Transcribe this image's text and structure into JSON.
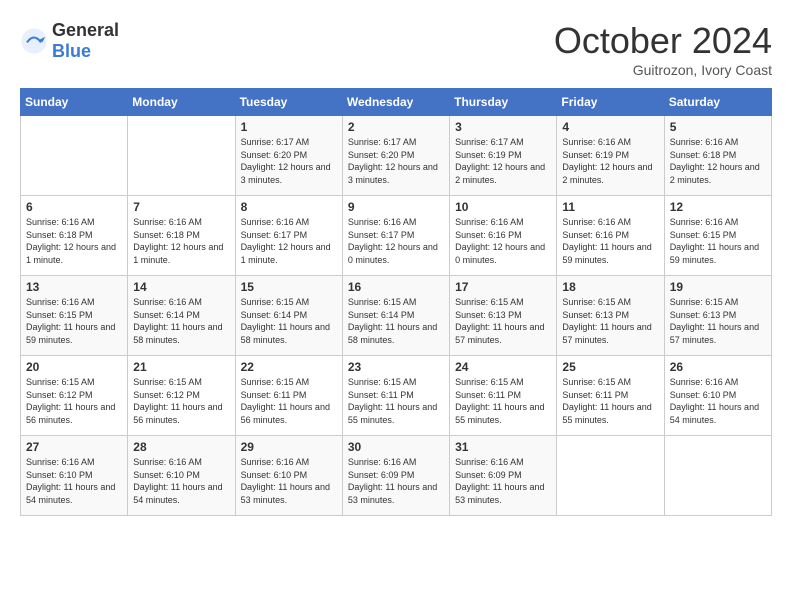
{
  "header": {
    "logo_general": "General",
    "logo_blue": "Blue",
    "month_title": "October 2024",
    "location": "Guitrozon, Ivory Coast"
  },
  "days_of_week": [
    "Sunday",
    "Monday",
    "Tuesday",
    "Wednesday",
    "Thursday",
    "Friday",
    "Saturday"
  ],
  "weeks": [
    [
      {
        "day": "",
        "info": ""
      },
      {
        "day": "",
        "info": ""
      },
      {
        "day": "1",
        "info": "Sunrise: 6:17 AM\nSunset: 6:20 PM\nDaylight: 12 hours and 3 minutes."
      },
      {
        "day": "2",
        "info": "Sunrise: 6:17 AM\nSunset: 6:20 PM\nDaylight: 12 hours and 3 minutes."
      },
      {
        "day": "3",
        "info": "Sunrise: 6:17 AM\nSunset: 6:19 PM\nDaylight: 12 hours and 2 minutes."
      },
      {
        "day": "4",
        "info": "Sunrise: 6:16 AM\nSunset: 6:19 PM\nDaylight: 12 hours and 2 minutes."
      },
      {
        "day": "5",
        "info": "Sunrise: 6:16 AM\nSunset: 6:18 PM\nDaylight: 12 hours and 2 minutes."
      }
    ],
    [
      {
        "day": "6",
        "info": "Sunrise: 6:16 AM\nSunset: 6:18 PM\nDaylight: 12 hours and 1 minute."
      },
      {
        "day": "7",
        "info": "Sunrise: 6:16 AM\nSunset: 6:18 PM\nDaylight: 12 hours and 1 minute."
      },
      {
        "day": "8",
        "info": "Sunrise: 6:16 AM\nSunset: 6:17 PM\nDaylight: 12 hours and 1 minute."
      },
      {
        "day": "9",
        "info": "Sunrise: 6:16 AM\nSunset: 6:17 PM\nDaylight: 12 hours and 0 minutes."
      },
      {
        "day": "10",
        "info": "Sunrise: 6:16 AM\nSunset: 6:16 PM\nDaylight: 12 hours and 0 minutes."
      },
      {
        "day": "11",
        "info": "Sunrise: 6:16 AM\nSunset: 6:16 PM\nDaylight: 11 hours and 59 minutes."
      },
      {
        "day": "12",
        "info": "Sunrise: 6:16 AM\nSunset: 6:15 PM\nDaylight: 11 hours and 59 minutes."
      }
    ],
    [
      {
        "day": "13",
        "info": "Sunrise: 6:16 AM\nSunset: 6:15 PM\nDaylight: 11 hours and 59 minutes."
      },
      {
        "day": "14",
        "info": "Sunrise: 6:16 AM\nSunset: 6:14 PM\nDaylight: 11 hours and 58 minutes."
      },
      {
        "day": "15",
        "info": "Sunrise: 6:15 AM\nSunset: 6:14 PM\nDaylight: 11 hours and 58 minutes."
      },
      {
        "day": "16",
        "info": "Sunrise: 6:15 AM\nSunset: 6:14 PM\nDaylight: 11 hours and 58 minutes."
      },
      {
        "day": "17",
        "info": "Sunrise: 6:15 AM\nSunset: 6:13 PM\nDaylight: 11 hours and 57 minutes."
      },
      {
        "day": "18",
        "info": "Sunrise: 6:15 AM\nSunset: 6:13 PM\nDaylight: 11 hours and 57 minutes."
      },
      {
        "day": "19",
        "info": "Sunrise: 6:15 AM\nSunset: 6:13 PM\nDaylight: 11 hours and 57 minutes."
      }
    ],
    [
      {
        "day": "20",
        "info": "Sunrise: 6:15 AM\nSunset: 6:12 PM\nDaylight: 11 hours and 56 minutes."
      },
      {
        "day": "21",
        "info": "Sunrise: 6:15 AM\nSunset: 6:12 PM\nDaylight: 11 hours and 56 minutes."
      },
      {
        "day": "22",
        "info": "Sunrise: 6:15 AM\nSunset: 6:11 PM\nDaylight: 11 hours and 56 minutes."
      },
      {
        "day": "23",
        "info": "Sunrise: 6:15 AM\nSunset: 6:11 PM\nDaylight: 11 hours and 55 minutes."
      },
      {
        "day": "24",
        "info": "Sunrise: 6:15 AM\nSunset: 6:11 PM\nDaylight: 11 hours and 55 minutes."
      },
      {
        "day": "25",
        "info": "Sunrise: 6:15 AM\nSunset: 6:11 PM\nDaylight: 11 hours and 55 minutes."
      },
      {
        "day": "26",
        "info": "Sunrise: 6:16 AM\nSunset: 6:10 PM\nDaylight: 11 hours and 54 minutes."
      }
    ],
    [
      {
        "day": "27",
        "info": "Sunrise: 6:16 AM\nSunset: 6:10 PM\nDaylight: 11 hours and 54 minutes."
      },
      {
        "day": "28",
        "info": "Sunrise: 6:16 AM\nSunset: 6:10 PM\nDaylight: 11 hours and 54 minutes."
      },
      {
        "day": "29",
        "info": "Sunrise: 6:16 AM\nSunset: 6:10 PM\nDaylight: 11 hours and 53 minutes."
      },
      {
        "day": "30",
        "info": "Sunrise: 6:16 AM\nSunset: 6:09 PM\nDaylight: 11 hours and 53 minutes."
      },
      {
        "day": "31",
        "info": "Sunrise: 6:16 AM\nSunset: 6:09 PM\nDaylight: 11 hours and 53 minutes."
      },
      {
        "day": "",
        "info": ""
      },
      {
        "day": "",
        "info": ""
      }
    ]
  ]
}
